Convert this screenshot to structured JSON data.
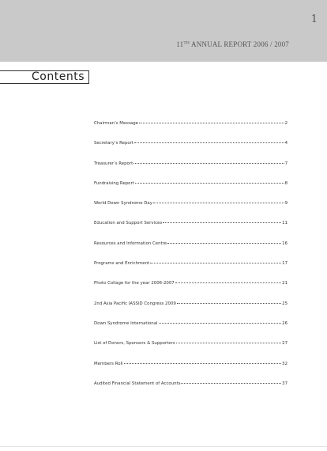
{
  "header": {
    "page_number": "1",
    "report_title_prefix": "11",
    "report_title_sup": "TH",
    "report_title_rest": " ANNUAL REPORT 2006 / 2007"
  },
  "contents": {
    "title": "Contents",
    "entries": [
      {
        "label": "Chairman’s Message",
        "page": "2"
      },
      {
        "label": "Secretary’s Report",
        "page": "4"
      },
      {
        "label": "Treasurer’s Report",
        "page": "7"
      },
      {
        "label": "Fundraising Report",
        "page": "8"
      },
      {
        "label": "World Down Syndrome Day",
        "page": "9"
      },
      {
        "label": "Education and Support Services",
        "page": "11"
      },
      {
        "label": "Resources and Information Centre",
        "page": "16"
      },
      {
        "label": "Programs and Enrichment",
        "page": "17"
      },
      {
        "label": "Photo Collage for the year 2006-2007",
        "page": "21"
      },
      {
        "label": "2nd Asia Pacific IASSID Congress 2009",
        "page": "25"
      },
      {
        "label": "Down Syndrome International",
        "page": "26"
      },
      {
        "label": "List of Donors, Sponsors & Supporters",
        "page": "27"
      },
      {
        "label": "Members Roll",
        "page": "32"
      },
      {
        "label": "Audited Financial Statement of Accounts",
        "page": "37"
      }
    ]
  },
  "colors": {
    "header_band": "#c9c9c9",
    "header_text": "#555555",
    "body_text": "#333333"
  }
}
